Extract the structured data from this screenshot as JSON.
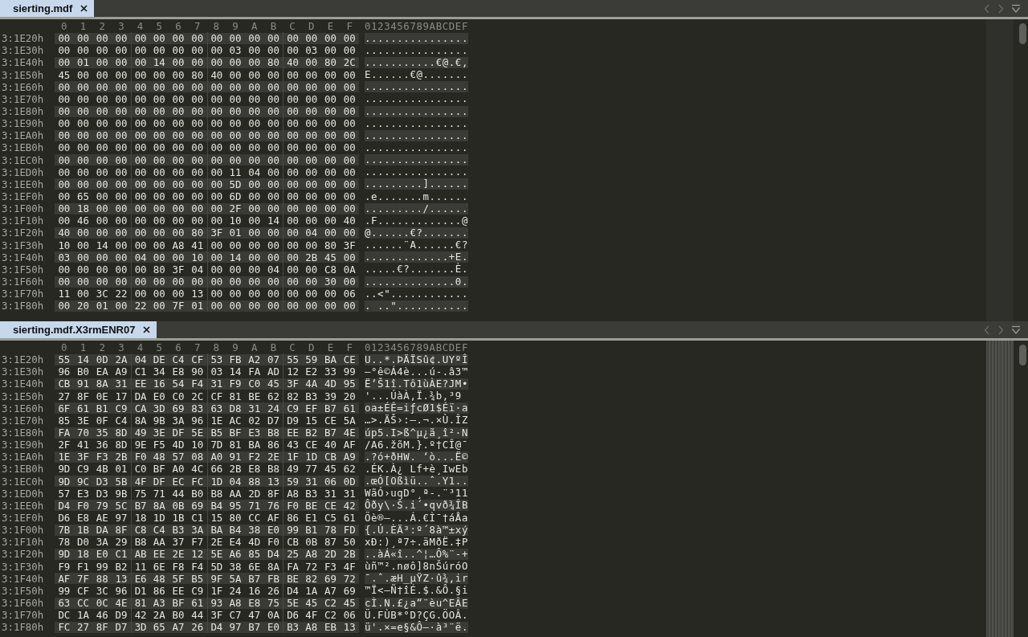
{
  "panes": [
    {
      "tab": {
        "label": "sierting.mdf",
        "selected": true
      },
      "column_headers": [
        "0",
        "1",
        "2",
        "3",
        "4",
        "5",
        "6",
        "7",
        "8",
        "9",
        "A",
        "B",
        "C",
        "D",
        "E",
        "F"
      ],
      "text_header": "0123456789ABCDEF",
      "rows": [
        {
          "address": "3:1E20h",
          "bytes": [
            "00",
            "00",
            "00",
            "00",
            "00",
            "00",
            "00",
            "00",
            "00",
            "00",
            "00",
            "00",
            "00",
            "00",
            "00",
            "00"
          ],
          "text": "................"
        },
        {
          "address": "3:1E30h",
          "bytes": [
            "00",
            "00",
            "00",
            "00",
            "00",
            "00",
            "00",
            "00",
            "00",
            "03",
            "00",
            "00",
            "00",
            "03",
            "00",
            "00"
          ],
          "text": "................"
        },
        {
          "address": "3:1E40h",
          "bytes": [
            "00",
            "01",
            "00",
            "00",
            "00",
            "14",
            "00",
            "00",
            "00",
            "00",
            "00",
            "80",
            "40",
            "00",
            "80",
            "2C"
          ],
          "text": "...........€@.€,"
        },
        {
          "address": "3:1E50h",
          "bytes": [
            "45",
            "00",
            "00",
            "00",
            "00",
            "00",
            "00",
            "80",
            "40",
            "00",
            "00",
            "00",
            "00",
            "00",
            "00",
            "00"
          ],
          "text": "E......€@......."
        },
        {
          "address": "3:1E60h",
          "bytes": [
            "00",
            "00",
            "00",
            "00",
            "00",
            "00",
            "00",
            "00",
            "00",
            "00",
            "00",
            "00",
            "00",
            "00",
            "00",
            "00"
          ],
          "text": "................"
        },
        {
          "address": "3:1E70h",
          "bytes": [
            "00",
            "00",
            "00",
            "00",
            "00",
            "00",
            "00",
            "00",
            "00",
            "00",
            "00",
            "00",
            "00",
            "00",
            "00",
            "00"
          ],
          "text": "................"
        },
        {
          "address": "3:1E80h",
          "bytes": [
            "00",
            "00",
            "00",
            "00",
            "00",
            "00",
            "00",
            "00",
            "00",
            "00",
            "00",
            "00",
            "00",
            "00",
            "00",
            "00"
          ],
          "text": "................"
        },
        {
          "address": "3:1E90h",
          "bytes": [
            "00",
            "00",
            "00",
            "00",
            "00",
            "00",
            "00",
            "00",
            "00",
            "00",
            "00",
            "00",
            "00",
            "00",
            "00",
            "00"
          ],
          "text": "................"
        },
        {
          "address": "3:1EA0h",
          "bytes": [
            "00",
            "00",
            "00",
            "00",
            "00",
            "00",
            "00",
            "00",
            "00",
            "00",
            "00",
            "00",
            "00",
            "00",
            "00",
            "00"
          ],
          "text": "................"
        },
        {
          "address": "3:1EB0h",
          "bytes": [
            "00",
            "00",
            "00",
            "00",
            "00",
            "00",
            "00",
            "00",
            "00",
            "00",
            "00",
            "00",
            "00",
            "00",
            "00",
            "00"
          ],
          "text": "................"
        },
        {
          "address": "3:1EC0h",
          "bytes": [
            "00",
            "00",
            "00",
            "00",
            "00",
            "00",
            "00",
            "00",
            "00",
            "00",
            "00",
            "00",
            "00",
            "00",
            "00",
            "00"
          ],
          "text": "................"
        },
        {
          "address": "3:1ED0h",
          "bytes": [
            "00",
            "00",
            "00",
            "00",
            "00",
            "00",
            "00",
            "00",
            "00",
            "11",
            "04",
            "00",
            "00",
            "00",
            "00",
            "00"
          ],
          "text": "................"
        },
        {
          "address": "3:1EE0h",
          "bytes": [
            "00",
            "00",
            "00",
            "00",
            "00",
            "00",
            "00",
            "00",
            "00",
            "5D",
            "00",
            "00",
            "00",
            "00",
            "00",
            "00"
          ],
          "text": ".........]......"
        },
        {
          "address": "3:1EF0h",
          "bytes": [
            "00",
            "65",
            "00",
            "00",
            "00",
            "00",
            "00",
            "00",
            "00",
            "6D",
            "00",
            "00",
            "00",
            "00",
            "00",
            "00"
          ],
          "text": ".e.......m......"
        },
        {
          "address": "3:1F00h",
          "bytes": [
            "00",
            "18",
            "00",
            "00",
            "00",
            "00",
            "00",
            "00",
            "00",
            "2F",
            "00",
            "00",
            "00",
            "00",
            "00",
            "00"
          ],
          "text": "........./......"
        },
        {
          "address": "3:1F10h",
          "bytes": [
            "00",
            "46",
            "00",
            "00",
            "00",
            "00",
            "00",
            "00",
            "00",
            "10",
            "00",
            "14",
            "00",
            "00",
            "00",
            "40"
          ],
          "text": ".F.............@"
        },
        {
          "address": "3:1F20h",
          "bytes": [
            "40",
            "00",
            "00",
            "00",
            "00",
            "00",
            "00",
            "80",
            "3F",
            "01",
            "00",
            "00",
            "00",
            "04",
            "00",
            "00"
          ],
          "text": "@......€?......."
        },
        {
          "address": "3:1F30h",
          "bytes": [
            "10",
            "00",
            "14",
            "00",
            "00",
            "00",
            "A8",
            "41",
            "00",
            "00",
            "00",
            "00",
            "00",
            "00",
            "80",
            "3F"
          ],
          "text": "......¨A......€?"
        },
        {
          "address": "3:1F40h",
          "bytes": [
            "03",
            "00",
            "00",
            "00",
            "04",
            "00",
            "00",
            "10",
            "00",
            "14",
            "00",
            "00",
            "00",
            "2B",
            "45",
            "00"
          ],
          "text": ".............+E."
        },
        {
          "address": "3:1F50h",
          "bytes": [
            "00",
            "00",
            "00",
            "00",
            "00",
            "80",
            "3F",
            "04",
            "00",
            "00",
            "00",
            "04",
            "00",
            "00",
            "C8",
            "0A"
          ],
          "text": ".....€?.......È."
        },
        {
          "address": "3:1F60h",
          "bytes": [
            "00",
            "00",
            "00",
            "00",
            "00",
            "00",
            "00",
            "00",
            "00",
            "00",
            "00",
            "00",
            "00",
            "00",
            "30",
            "00"
          ],
          "text": "..............0."
        },
        {
          "address": "3:1F70h",
          "bytes": [
            "11",
            "00",
            "3C",
            "22",
            "00",
            "00",
            "00",
            "13",
            "00",
            "00",
            "00",
            "00",
            "00",
            "00",
            "00",
            "06"
          ],
          "text": "..<\"............"
        },
        {
          "address": "3:1F80h",
          "bytes": [
            "00",
            "20",
            "01",
            "00",
            "22",
            "00",
            "7F",
            "01",
            "00",
            "00",
            "00",
            "00",
            "00",
            "00",
            "00",
            "00"
          ],
          "text": ". ..\"..........."
        }
      ]
    },
    {
      "tab": {
        "label": "sierting.mdf.X3rmENR07",
        "selected": true
      },
      "column_headers": [
        "0",
        "1",
        "2",
        "3",
        "4",
        "5",
        "6",
        "7",
        "8",
        "9",
        "A",
        "B",
        "C",
        "D",
        "E",
        "F"
      ],
      "text_header": "0123456789ABCDEF",
      "rows": [
        {
          "address": "3:1E20h",
          "bytes": [
            "55",
            "14",
            "0D",
            "2A",
            "04",
            "DE",
            "C4",
            "CF",
            "53",
            "FB",
            "A2",
            "07",
            "55",
            "59",
            "BA",
            "CE"
          ],
          "text": "U..*.ÞÄÏSû¢.UYºÎ"
        },
        {
          "address": "3:1E30h",
          "bytes": [
            "96",
            "B0",
            "EA",
            "A9",
            "C1",
            "34",
            "E8",
            "90",
            "03",
            "14",
            "FA",
            "AD",
            "12",
            "E2",
            "33",
            "99"
          ],
          "text": "–°ê©Á4è...ú-.â3™"
        },
        {
          "address": "3:1E40h",
          "bytes": [
            "CB",
            "91",
            "8A",
            "31",
            "EE",
            "16",
            "54",
            "F4",
            "31",
            "F9",
            "C0",
            "45",
            "3F",
            "4A",
            "4D",
            "95"
          ],
          "text": "Ë‘Š1î.Tô1ùÀE?JM•"
        },
        {
          "address": "3:1E50h",
          "bytes": [
            "27",
            "8F",
            "0E",
            "17",
            "DA",
            "E0",
            "C0",
            "2C",
            "CF",
            "81",
            "BE",
            "62",
            "82",
            "B3",
            "39",
            "20"
          ],
          "text": "'...ÚàÀ,Ï.¾b‚³9 "
        },
        {
          "address": "3:1E60h",
          "bytes": [
            "6F",
            "61",
            "B1",
            "C9",
            "CA",
            "3D",
            "69",
            "83",
            "63",
            "D8",
            "31",
            "24",
            "C9",
            "EF",
            "B7",
            "61"
          ],
          "text": "oa±ÉÊ=iƒcØ1$Éï·a"
        },
        {
          "address": "3:1E70h",
          "bytes": [
            "85",
            "3E",
            "0F",
            "C4",
            "8A",
            "9B",
            "3A",
            "96",
            "1E",
            "AC",
            "02",
            "D7",
            "D9",
            "15",
            "CE",
            "5A"
          ],
          "text": "…>.ÄŠ›:–.¬.×Ù.ÎZ"
        },
        {
          "address": "3:1E80h",
          "bytes": [
            "FA",
            "70",
            "35",
            "8D",
            "49",
            "3E",
            "DF",
            "5E",
            "B5",
            "BF",
            "E3",
            "B8",
            "EE",
            "B2",
            "B7",
            "4E"
          ],
          "text": "úp5.I>ß^µ¿ã¸î²·N"
        },
        {
          "address": "3:1E90h",
          "bytes": [
            "2F",
            "41",
            "36",
            "8D",
            "9E",
            "F5",
            "4D",
            "10",
            "7D",
            "81",
            "BA",
            "86",
            "43",
            "CE",
            "40",
            "AF"
          ],
          "text": "/A6.žõM.}.º†CÎ@¯"
        },
        {
          "address": "3:1EA0h",
          "bytes": [
            "1E",
            "3F",
            "F3",
            "2B",
            "F0",
            "48",
            "57",
            "08",
            "A0",
            "91",
            "F2",
            "2E",
            "1F",
            "1D",
            "CB",
            "A9"
          ],
          "text": ".?ó+ðHW. ‘ò...Ë©"
        },
        {
          "address": "3:1EB0h",
          "bytes": [
            "9D",
            "C9",
            "4B",
            "01",
            "C0",
            "BF",
            "A0",
            "4C",
            "66",
            "2B",
            "E8",
            "B8",
            "49",
            "77",
            "45",
            "62"
          ],
          "text": ".ÉK.À¿ Lf+è¸IwEb"
        },
        {
          "address": "3:1EC0h",
          "bytes": [
            "9D",
            "9C",
            "D3",
            "5B",
            "4F",
            "DF",
            "EC",
            "FC",
            "1D",
            "04",
            "88",
            "13",
            "59",
            "31",
            "06",
            "0D"
          ],
          "text": ".œÓ[Oßìü..ˆ.Y1.."
        },
        {
          "address": "3:1ED0h",
          "bytes": [
            "57",
            "E3",
            "D3",
            "9B",
            "75",
            "71",
            "44",
            "B0",
            "B8",
            "AA",
            "2D",
            "8F",
            "A8",
            "B3",
            "31",
            "31"
          ],
          "text": "WãÓ›uqD°¸ª-.¨³11"
        },
        {
          "address": "3:1EE0h",
          "bytes": [
            "D4",
            "F0",
            "79",
            "5C",
            "B7",
            "8A",
            "0B",
            "69",
            "B4",
            "95",
            "71",
            "76",
            "F0",
            "BE",
            "CE",
            "42"
          ],
          "text": "Ôðy\\·Š.i´•qvð¾ÎB"
        },
        {
          "address": "3:1EF0h",
          "bytes": [
            "D6",
            "E8",
            "AE",
            "97",
            "18",
            "1D",
            "1B",
            "C1",
            "15",
            "80",
            "CC",
            "AF",
            "86",
            "E1",
            "C5",
            "61"
          ],
          "text": "Öè®—...Á.€Ì¯†áÅa"
        },
        {
          "address": "3:1F00h",
          "bytes": [
            "7B",
            "1B",
            "DA",
            "8F",
            "C8",
            "C4",
            "B3",
            "3A",
            "BA",
            "B4",
            "38",
            "E0",
            "99",
            "B1",
            "78",
            "FD"
          ],
          "text": "{.Ú.ÈÄ³:º´8à™±xý"
        },
        {
          "address": "3:1F10h",
          "bytes": [
            "78",
            "D0",
            "3A",
            "29",
            "B8",
            "AA",
            "37",
            "F7",
            "2E",
            "E4",
            "4D",
            "F0",
            "CB",
            "0B",
            "87",
            "50"
          ],
          "text": "xÐ:)¸ª7÷.äMðË.‡P"
        },
        {
          "address": "3:1F20h",
          "bytes": [
            "9D",
            "18",
            "E0",
            "C1",
            "AB",
            "EE",
            "2E",
            "12",
            "5E",
            "A6",
            "85",
            "D4",
            "25",
            "A8",
            "2D",
            "2B"
          ],
          "text": "..àÁ«î..^¦…Ô%¨-+"
        },
        {
          "address": "3:1F30h",
          "bytes": [
            "F9",
            "F1",
            "99",
            "B2",
            "11",
            "6E",
            "F8",
            "F4",
            "5D",
            "38",
            "6E",
            "8A",
            "FA",
            "72",
            "F3",
            "4F"
          ],
          "text": "ùñ™².nøô]8nŠúróO"
        },
        {
          "address": "3:1F40h",
          "bytes": [
            "AF",
            "7F",
            "88",
            "13",
            "E6",
            "48",
            "5F",
            "B5",
            "9F",
            "5A",
            "B7",
            "FB",
            "BE",
            "82",
            "69",
            "72"
          ],
          "text": "¯.ˆ.æH_µŸZ·û¾‚ir"
        },
        {
          "address": "3:1F50h",
          "bytes": [
            "99",
            "CF",
            "3C",
            "96",
            "D1",
            "86",
            "EE",
            "C9",
            "1F",
            "24",
            "16",
            "26",
            "D4",
            "1A",
            "A7",
            "69"
          ],
          "text": "™Ï<–Ñ†îÉ.$.&Ô.§i"
        },
        {
          "address": "3:1F60h",
          "bytes": [
            "63",
            "CC",
            "0C",
            "4E",
            "81",
            "A3",
            "BF",
            "61",
            "93",
            "A8",
            "E8",
            "75",
            "5E",
            "45",
            "C2",
            "45"
          ],
          "text": "cÌ.N.£¿a“¨èu^EÂE"
        },
        {
          "address": "3:1F70h",
          "bytes": [
            "DC",
            "1A",
            "46",
            "D9",
            "42",
            "2A",
            "B0",
            "44",
            "3F",
            "C7",
            "47",
            "0A",
            "D6",
            "4F",
            "C2",
            "06"
          ],
          "text": "Ü.FÙB*°D?ÇG.ÖOÂ."
        },
        {
          "address": "3:1F80h",
          "bytes": [
            "FC",
            "27",
            "8F",
            "D7",
            "3D",
            "65",
            "A7",
            "26",
            "D4",
            "97",
            "B7",
            "E0",
            "B3",
            "A8",
            "EB",
            "13"
          ],
          "text": "ü'.×=e§&Ô—·à³¨ë."
        }
      ]
    }
  ]
}
